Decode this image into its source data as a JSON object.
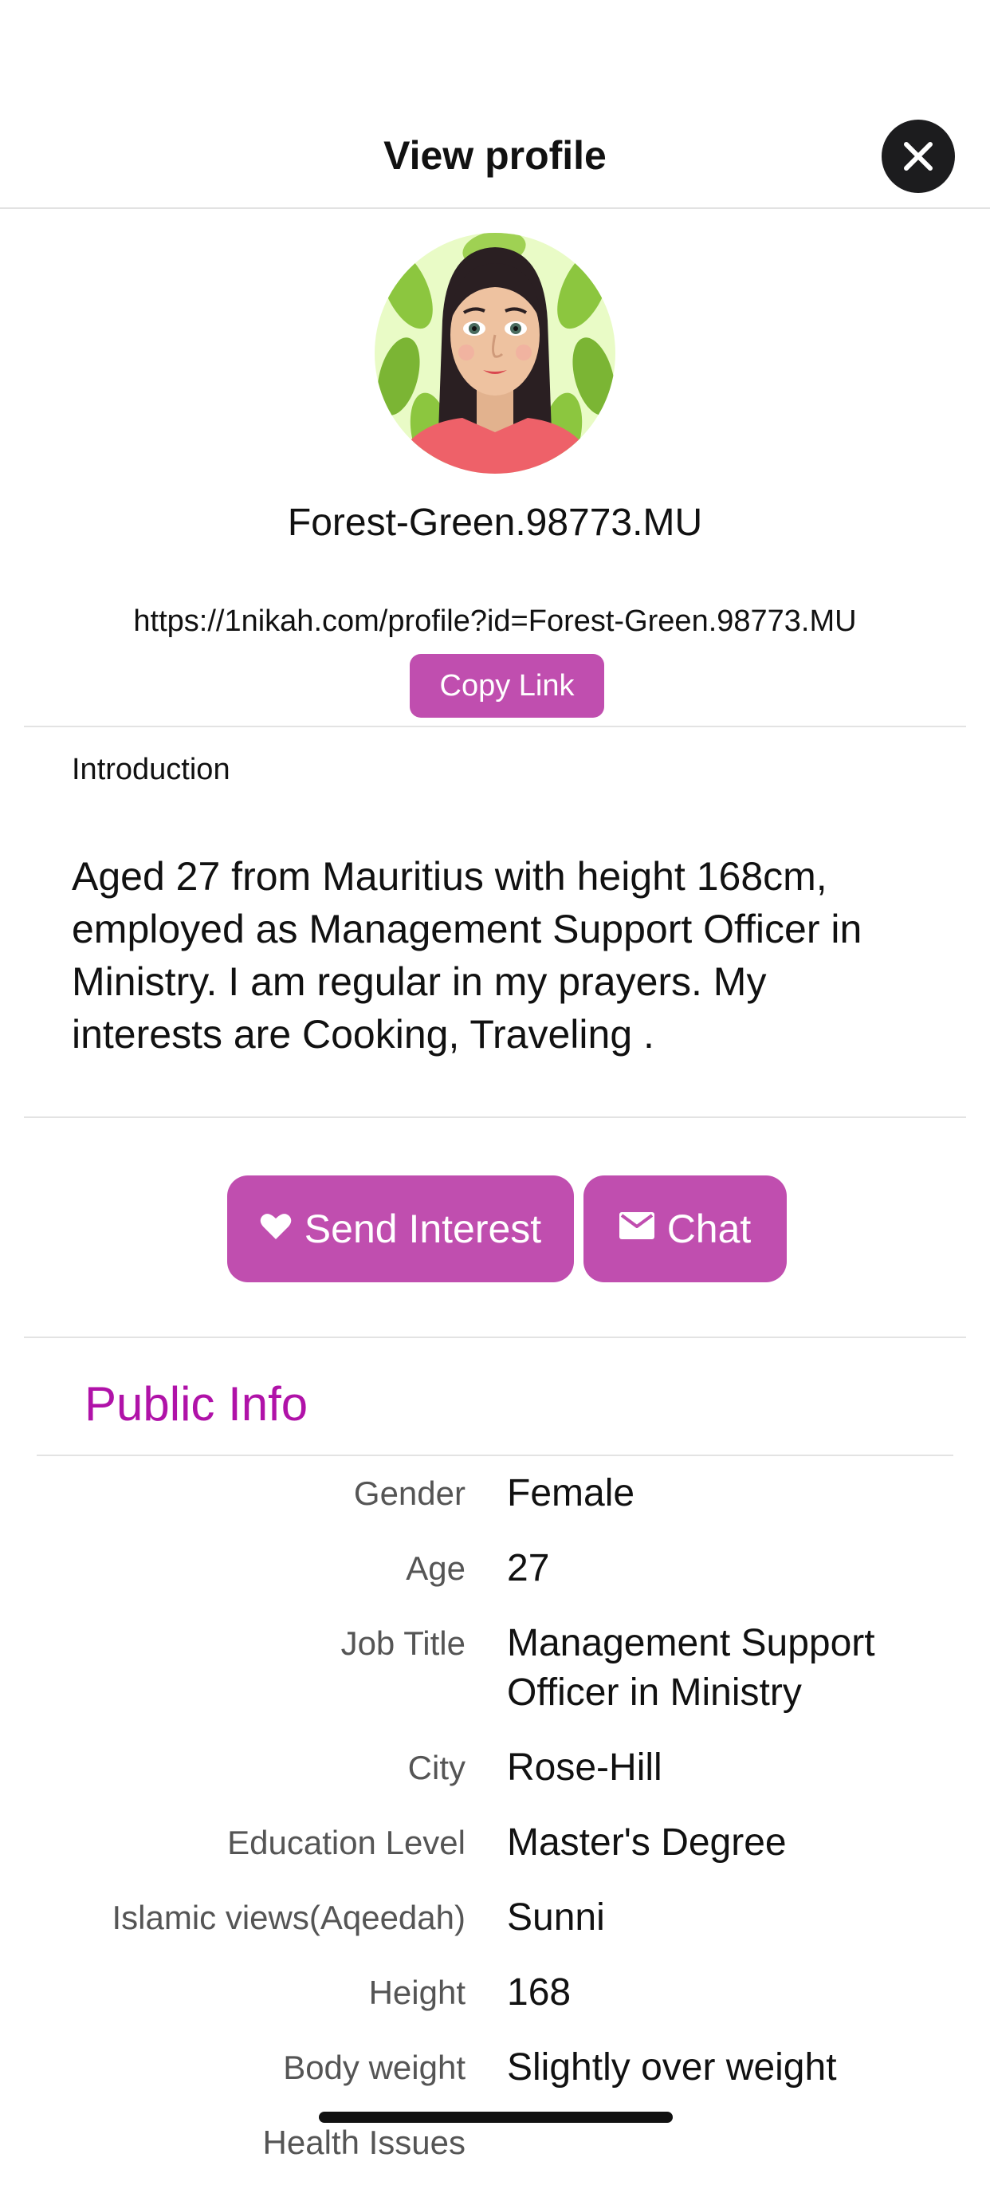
{
  "header": {
    "title": "View profile"
  },
  "profile": {
    "username": "Forest-Green.98773.MU",
    "url": "https://1nikah.com/profile?id=Forest-Green.98773.MU",
    "copy_label": "Copy Link"
  },
  "introduction": {
    "label": "Introduction",
    "text": "Aged 27  from Mauritius with height 168cm, employed as Management Support Officer in Ministry. I am regular in my prayers. My interests are Cooking, Traveling ."
  },
  "actions": {
    "send_interest": "Send Interest",
    "chat": "Chat"
  },
  "public_info": {
    "title": "Public Info",
    "rows": [
      {
        "label": "Gender",
        "value": "Female"
      },
      {
        "label": "Age",
        "value": "27"
      },
      {
        "label": "Job Title",
        "value": "Management Support Officer in Ministry"
      },
      {
        "label": "City",
        "value": "Rose-Hill"
      },
      {
        "label": "Education Level",
        "value": "Master's Degree"
      },
      {
        "label": "Islamic views(Aqeedah)",
        "value": "Sunni"
      },
      {
        "label": "Height",
        "value": "168"
      },
      {
        "label": "Body weight",
        "value": "Slightly over weight"
      },
      {
        "label": "Health Issues",
        "value": ""
      }
    ]
  },
  "colors": {
    "accent": "#c04eaf",
    "section_title": "#b012a8",
    "close_button": "#1c1c1e"
  }
}
